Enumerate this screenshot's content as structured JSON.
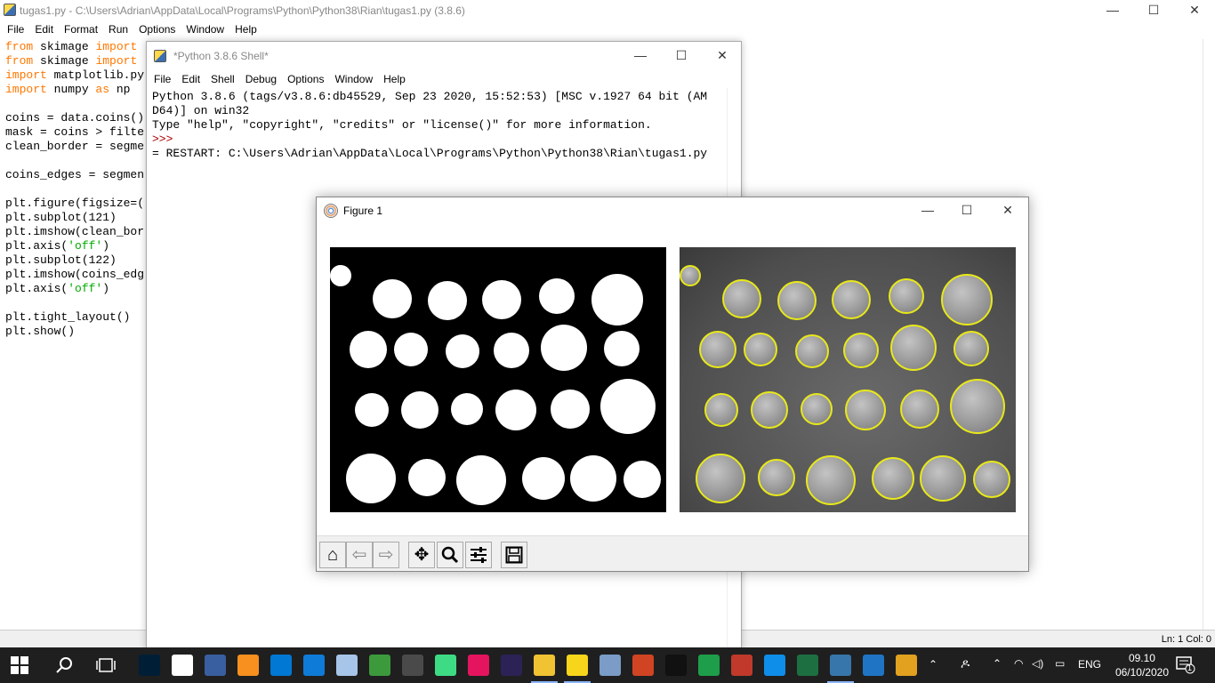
{
  "editor": {
    "title": "tugas1.py - C:\\Users\\Adrian\\AppData\\Local\\Programs\\Python\\Python38\\Rian\\tugas1.py (3.8.6)",
    "menu": [
      "File",
      "Edit",
      "Format",
      "Run",
      "Options",
      "Window",
      "Help"
    ],
    "code": {
      "l1a": "from",
      "l1b": " skimage ",
      "l1c": "import",
      "l2a": "from",
      "l2b": " skimage ",
      "l2c": "import",
      "l3a": "import",
      "l3b": " matplotlib.py",
      "l4a": "import",
      "l4b": " numpy ",
      "l4c": "as",
      "l4d": " np",
      "l6": "coins = data.coins()",
      "l7": "mask = coins > filte",
      "l8": "clean_border = segme",
      "l10": "coins_edges = segmen",
      "l12": "plt.figure(figsize=(",
      "l13": "plt.subplot(121)",
      "l14": "plt.imshow(clean_bor",
      "l15a": "plt.axis(",
      "l15b": "'off'",
      "l15c": ")",
      "l16": "plt.subplot(122)",
      "l17": "plt.imshow(coins_edg",
      "l18a": "plt.axis(",
      "l18b": "'off'",
      "l18c": ")",
      "l20": "plt.tight_layout()",
      "l21": "plt.show()"
    },
    "status": "Ln: 1   Col: 0"
  },
  "shell": {
    "title": "*Python 3.8.6 Shell*",
    "menu": [
      "File",
      "Edit",
      "Shell",
      "Debug",
      "Options",
      "Window",
      "Help"
    ],
    "line1": "Python 3.8.6 (tags/v3.8.6:db45529, Sep 23 2020, 15:52:53) [MSC v.1927 64 bit (AM",
    "line2": "D64)] on win32",
    "line3": "Type \"help\", \"copyright\", \"credits\" or \"license()\" for more information.",
    "prompt": ">>>",
    "restart": "= RESTART: C:\\Users\\Adrian\\AppData\\Local\\Programs\\Python\\Python38\\Rian\\tugas1.py"
  },
  "figure": {
    "title": "Figure 1",
    "toolbar": [
      "home-icon",
      "back-icon",
      "forward-icon",
      "pan-icon",
      "zoom-icon",
      "configure-icon",
      "save-icon"
    ]
  },
  "window_controls": {
    "minimize": "—",
    "maximize": "☐",
    "close": "✕"
  },
  "taskbar": {
    "language": "ENG",
    "time": "09.10",
    "date": "06/10/2020",
    "notification_count": "1",
    "apps": [
      "photoshop",
      "chrome",
      "devcpp",
      "sublime",
      "vscode",
      "edge",
      "virtualbox",
      "inkscape",
      "ccleaner",
      "android-studio",
      "oo",
      "eclipse",
      "file-explorer",
      "sticky-notes",
      "paint3d",
      "powerpoint",
      "cmd",
      "ring",
      "krita",
      "teamviewer",
      "excel",
      "python-idle",
      "photos",
      "video"
    ],
    "accent": "#8ab4f8"
  }
}
